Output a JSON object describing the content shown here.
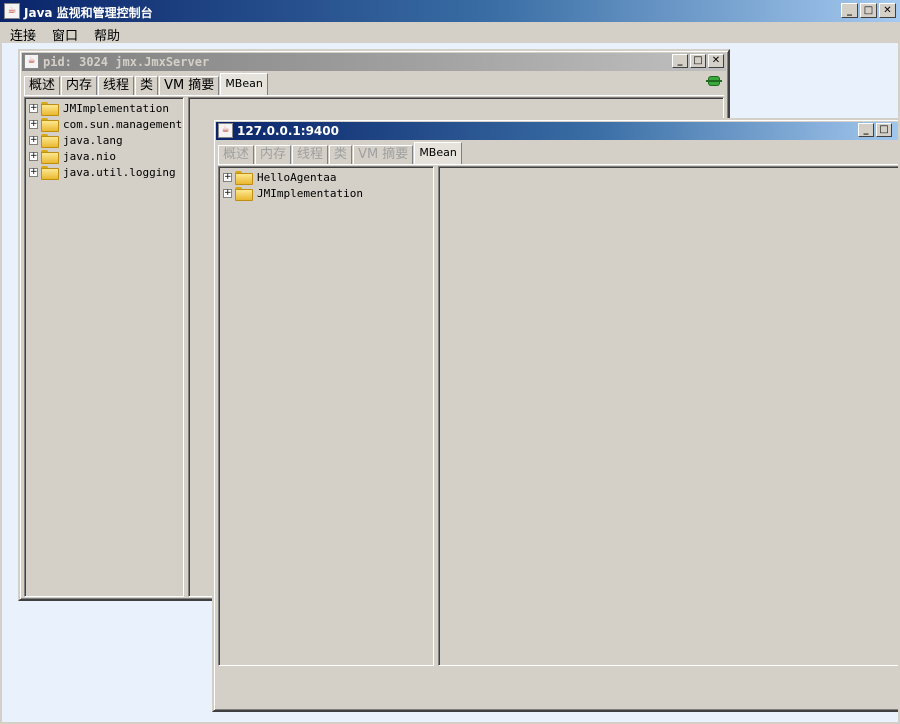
{
  "app": {
    "title": "Java 监视和管理控制台",
    "icon": "java-cup-icon",
    "buttons": {
      "minimize": "_",
      "maximize": "□",
      "close": "✕"
    }
  },
  "menu": {
    "items": [
      "连接",
      "窗口",
      "帮助"
    ]
  },
  "frame_back": {
    "title": "pid: 3024 jmx.JmxServer",
    "tabs": [
      "概述",
      "内存",
      "线程",
      "类",
      "VM 摘要",
      "MBean"
    ],
    "selected_tab": "MBean",
    "tree": [
      "JMImplementation",
      "com.sun.management",
      "java.lang",
      "java.nio",
      "java.util.logging"
    ],
    "expander": "+"
  },
  "frame_front": {
    "title": "127.0.0.1:9400",
    "tabs": [
      "概述",
      "内存",
      "线程",
      "类",
      "VM 摘要",
      "MBean"
    ],
    "selected_tab": "MBean",
    "tree": [
      "HelloAgentaa",
      "JMImplementation"
    ],
    "expander": "+"
  },
  "colors": {
    "title_active": "#0a246a",
    "title_inactive": "#808080",
    "desktop": "#e8f1fc",
    "face": "#d4d0c8",
    "connection": "#3aa83a"
  }
}
